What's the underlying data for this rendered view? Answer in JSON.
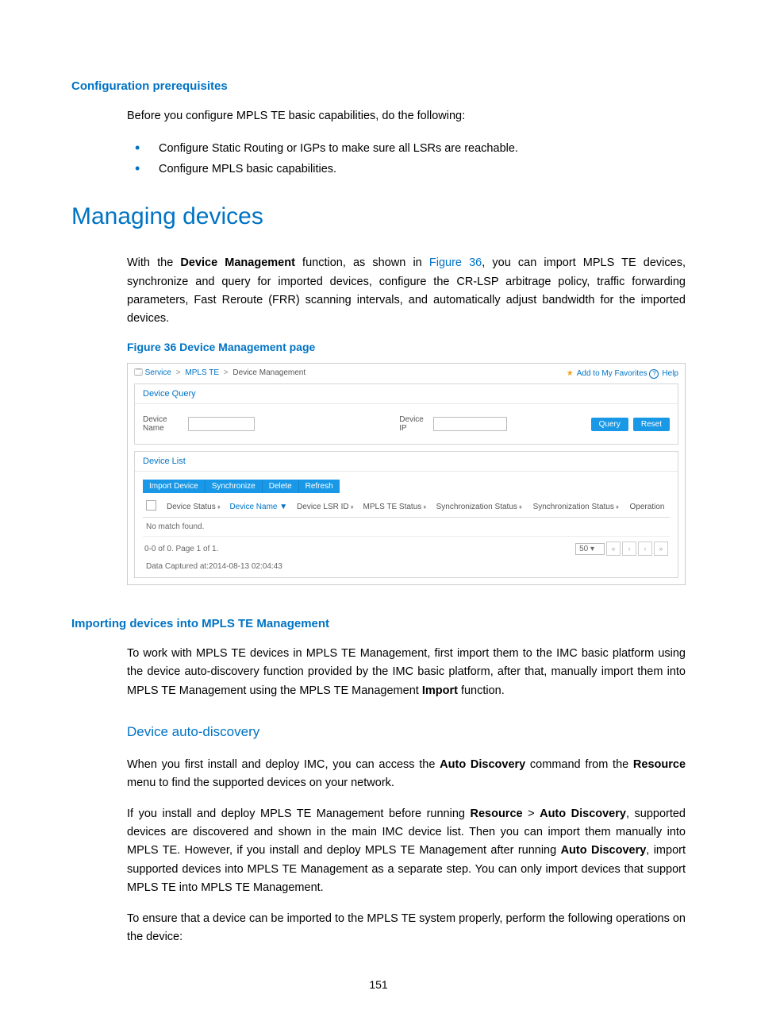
{
  "page_number": "151",
  "sec_config_prereq": {
    "title": "Configuration prerequisites",
    "intro": "Before you configure MPLS TE basic capabilities, do the following:",
    "bullets": [
      "Configure Static Routing or IGPs to make sure all LSRs are reachable.",
      "Configure MPLS basic capabilities."
    ]
  },
  "sec_managing_devices": {
    "title": "Managing devices",
    "para_pre": "With the ",
    "bold1": "Device Management",
    "para_mid1": " function, as shown in ",
    "link": "Figure 36",
    "para_post": ", you can import MPLS TE devices, synchronize and query for imported devices, configure the CR-LSP arbitrage policy, traffic forwarding parameters, Fast Reroute (FRR) scanning intervals, and automatically adjust bandwidth for the imported devices."
  },
  "figure": {
    "caption": "Figure 36 Device Management page",
    "crumb": {
      "a": "Service",
      "b": "MPLS TE",
      "c": "Device Management"
    },
    "top_links": {
      "fav": "Add to My Favorites",
      "help": "Help"
    },
    "query_panel": {
      "title": "Device Query",
      "lbl_name": "Device Name",
      "lbl_ip": "Device IP",
      "btn_query": "Query",
      "btn_reset": "Reset"
    },
    "list_panel": {
      "title": "Device List",
      "btn_import": "Import Device",
      "btn_sync": "Synchronize",
      "btn_delete": "Delete",
      "btn_refresh": "Refresh",
      "cols": {
        "status": "Device Status",
        "name": "Device Name",
        "lsrid": "Device LSR ID",
        "te": "MPLS TE Status",
        "sync1": "Synchronization Status",
        "sync2": "Synchronization Status",
        "op": "Operation"
      },
      "no_match": "No match found.",
      "pager_text": "0-0 of 0. Page 1 of 1.",
      "page_size": "50",
      "captured": "Data Captured at:2014-08-13 02:04:43"
    }
  },
  "sec_importing": {
    "title": "Importing devices into MPLS TE Management",
    "p1_a": "To work with MPLS TE devices in MPLS TE Management, first import them to the IMC basic platform using the device auto-discovery function provided by the IMC basic platform, after that, manually import them into MPLS TE Management using the MPLS TE Management ",
    "p1_bold": "Import",
    "p1_b": " function."
  },
  "sec_autodisc": {
    "title": "Device auto-discovery",
    "p1_a": "When you first install and deploy IMC, you can access the ",
    "p1_bold1": "Auto Discovery",
    "p1_b": " command from the ",
    "p1_bold2": "Resource",
    "p1_c": " menu to find the supported devices on your network.",
    "p2_a": "If you install and deploy MPLS TE Management before running ",
    "p2_bold1": "Resource",
    "p2_sep": " > ",
    "p2_bold2": "Auto Discovery",
    "p2_b": ", supported devices are discovered and shown in the main IMC device list. Then you can import them manually into MPLS TE. However, if you install and deploy MPLS TE Management after running ",
    "p2_bold3": "Auto Discovery",
    "p2_c": ", import supported devices into MPLS TE Management as a separate step. You can only import devices that support MPLS TE into MPLS TE Management.",
    "p3": "To ensure that a device can be imported to the MPLS TE system properly, perform the following operations on the device:"
  }
}
